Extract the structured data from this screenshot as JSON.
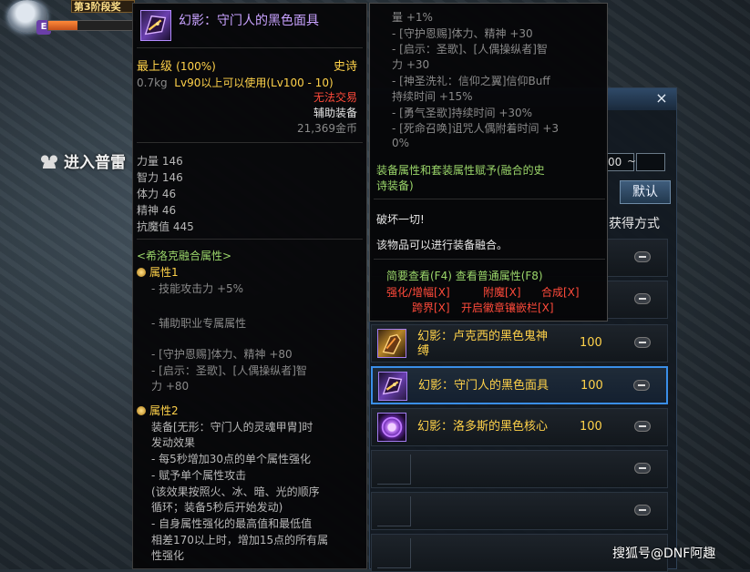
{
  "hud": {
    "stage_text": "第3阶段奖",
    "hp_fraction": 0.33,
    "badge": "E"
  },
  "scene": {
    "enter_label": "进入普雷"
  },
  "item_tooltip": {
    "name": "幻影：守门人的黑色面具",
    "grade_label": "最上级",
    "grade_percent": "(100%)",
    "rarity": "史诗",
    "weight": "0.7kg",
    "level_req": "Lv90以上可以使用(Lv100 - 10)",
    "trade": "无法交易",
    "slot": "辅助装备",
    "price": "21,369金币",
    "stats": [
      {
        "label": "力量",
        "value": "146"
      },
      {
        "label": "智力",
        "value": "146"
      },
      {
        "label": "体力",
        "value": "46"
      },
      {
        "label": "精神",
        "value": "46"
      },
      {
        "label": "抗魔值",
        "value": "445"
      }
    ],
    "fusion_header": "<希洛克融合属性>",
    "attr1_title": "属性1",
    "attr1_lines": [
      "- 技能攻击力 +5%",
      "",
      "- 辅助职业专属属性",
      "",
      "- [守护恩赐]体力、精神 +80",
      "- [启示：圣歌]、[人偶操纵者]智",
      "力 +80"
    ],
    "attr2_title": "属性2",
    "attr2_lines": [
      "装备[无形：守门人的灵魂甲胄]时",
      "发动效果",
      "- 每5秒增加30点的单个属性强化",
      "- 赋予单个属性攻击",
      "(该效果按照火、冰、暗、光的顺序",
      "循环；装备5秒后开始发动)",
      "- 自身属性强化的最高值和最低值",
      "相差170以上时，增加15点的所有属",
      "性强化"
    ]
  },
  "detail_tooltip": {
    "lines": [
      "量 +1%",
      "- [守护恩赐]体力、精神 +30",
      "- [启示：圣歌]、[人偶操纵者]智",
      "力 +30",
      "- [神圣洗礼：信仰之翼]信仰Buff",
      "持续时间 +15%",
      "- [勇气圣歌]持续时间 +30%",
      "- [死命召唤]诅咒人偶附着时间 +3",
      "0%"
    ],
    "fusion_note_1": "装备属性和套装属性赋予(融合的史",
    "fusion_note_2": "诗装备)",
    "flavor": "破坏一切!",
    "fusion_hint": "该物品可以进行装备融合。",
    "keys_line": "简要查看(F4) 查看普通属性(F8)",
    "actions_1": [
      "强化/增幅[X]",
      "附魔[X]",
      "合成[X]"
    ],
    "actions_2": [
      "跨界[X]",
      "开启徽章镶嵌栏[X]"
    ]
  },
  "panel": {
    "close_symbol": "×",
    "range_min": "00",
    "range_max": "",
    "tilde": "~",
    "default_button": "默认",
    "source_label": "获得方式",
    "items": [
      {
        "name_1": "幻影：卢克西的黑色鬼神",
        "name_2": "缚",
        "qty": "100",
        "icon": "gauntlet-icon",
        "selected": false
      },
      {
        "name_1": "幻影：守门人的黑色面具",
        "name_2": "",
        "qty": "100",
        "icon": "mask-icon",
        "selected": true
      },
      {
        "name_1": "幻影：洛多斯的黑色核心",
        "name_2": "",
        "qty": "100",
        "icon": "core-icon",
        "selected": false
      }
    ]
  },
  "watermark": "搜狐号@DNF阿趣",
  "colors": {
    "epic_gold": "#ffd24a",
    "epic_purple": "#c8a2ff",
    "stat_green": "#9bd66a",
    "warn_red": "#ff4a3a",
    "select_blue": "#3a8ee8"
  }
}
